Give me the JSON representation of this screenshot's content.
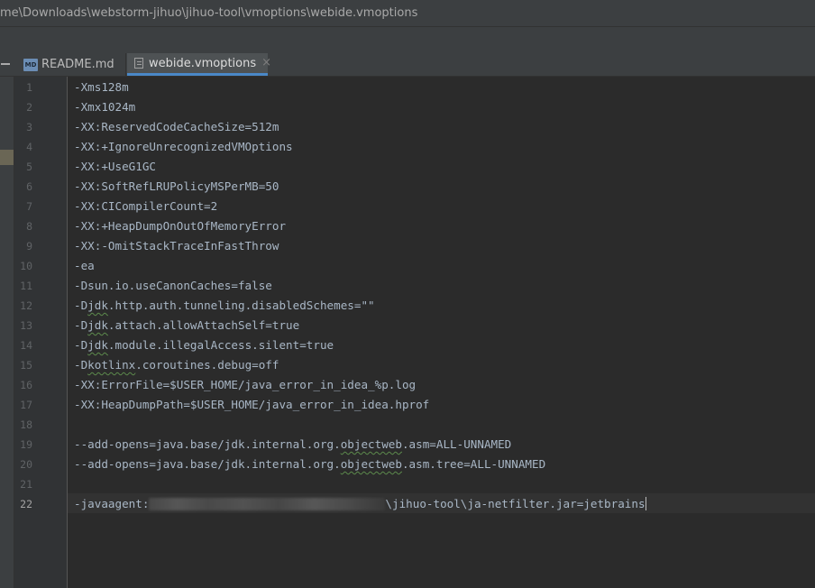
{
  "window": {
    "path": "me\\Downloads\\webstorm-jihuo\\jihuo-tool\\vmoptions\\webide.vmoptions"
  },
  "tabs": [
    {
      "label": "README.md",
      "icon": "markdown-file-icon",
      "active": false
    },
    {
      "label": "webide.vmoptions",
      "icon": "text-file-icon",
      "active": true
    }
  ],
  "editor": {
    "current_line": 22,
    "lines": [
      {
        "num": "1",
        "text": "-Xms128m"
      },
      {
        "num": "2",
        "text": "-Xmx1024m"
      },
      {
        "num": "3",
        "text": "-XX:ReservedCodeCacheSize=512m"
      },
      {
        "num": "4",
        "text": "-XX:+IgnoreUnrecognizedVMOptions"
      },
      {
        "num": "5",
        "text": "-XX:+UseG1GC"
      },
      {
        "num": "6",
        "text": "-XX:SoftRefLRUPolicyMSPerMB=50"
      },
      {
        "num": "7",
        "text": "-XX:CICompilerCount=2"
      },
      {
        "num": "8",
        "text": "-XX:+HeapDumpOnOutOfMemoryError"
      },
      {
        "num": "9",
        "text": "-XX:-OmitStackTraceInFastThrow"
      },
      {
        "num": "10",
        "text": "-ea"
      },
      {
        "num": "11",
        "text": "-Dsun.io.useCanonCaches=false"
      },
      {
        "num": "12",
        "pre": "-D",
        "sq": "jdk",
        "post": ".http.auth.tunneling.disabledSchemes=\"\""
      },
      {
        "num": "13",
        "pre": "-D",
        "sq": "jdk",
        "post": ".attach.allowAttachSelf=true"
      },
      {
        "num": "14",
        "pre": "-D",
        "sq": "jdk",
        "post": ".module.illegalAccess.silent=true"
      },
      {
        "num": "15",
        "pre": "-D",
        "sq": "kotlinx",
        "post": ".coroutines.debug=off"
      },
      {
        "num": "16",
        "text": "-XX:ErrorFile=$USER_HOME/java_error_in_idea_%p.log"
      },
      {
        "num": "17",
        "text": "-XX:HeapDumpPath=$USER_HOME/java_error_in_idea.hprof"
      },
      {
        "num": "18",
        "text": ""
      },
      {
        "num": "19",
        "pre": "--add-opens=java.base/jdk.internal.org.",
        "sq": "objectweb",
        "post": ".asm=ALL-UNNAMED"
      },
      {
        "num": "20",
        "pre": "--add-opens=java.base/jdk.internal.org.",
        "sq": "objectweb",
        "post": ".asm.tree=ALL-UNNAMED"
      },
      {
        "num": "21",
        "text": ""
      },
      {
        "num": "22",
        "pre": "-javaagent:",
        "redacted": true,
        "post": "\\jihuo-tool\\ja-netfilter.jar=jetbrains"
      }
    ]
  }
}
